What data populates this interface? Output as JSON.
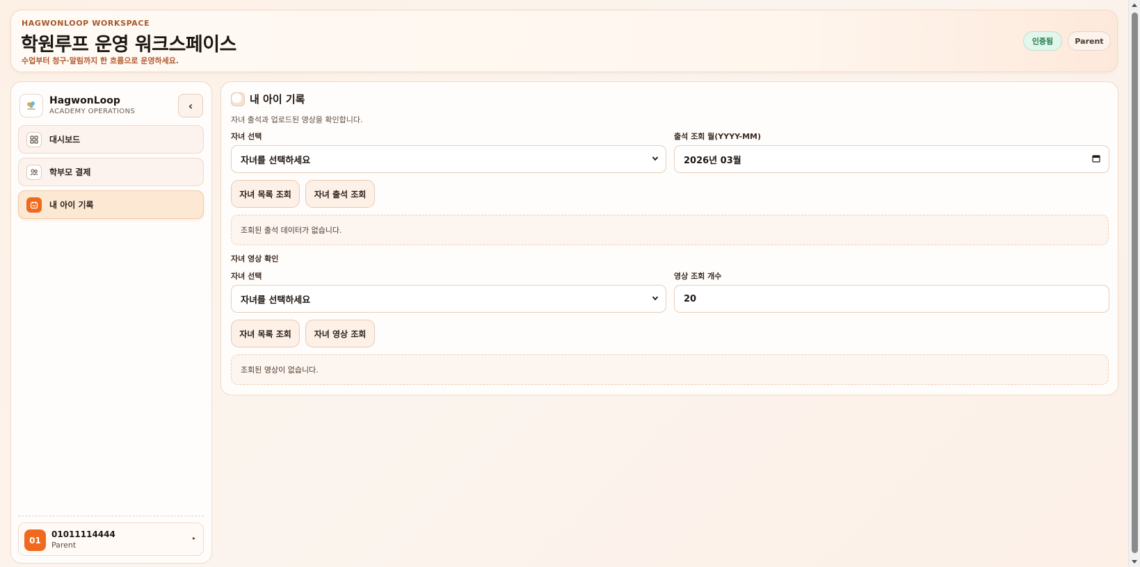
{
  "header": {
    "kicker": "HAGWONLOOP WORKSPACE",
    "title": "학원루프 운영 워크스페이스",
    "subtitle": "수업부터 청구·알림까지 한 흐름으로 운영하세요.",
    "badge_auth": "인증됨",
    "badge_role": "Parent"
  },
  "sidebar": {
    "brand_name": "HagwonLoop",
    "brand_sub": "ACADEMY OPERATIONS",
    "collapse_label": "‹",
    "items": [
      {
        "label": "대시보드",
        "icon": "dashboard-grid-icon",
        "active": false
      },
      {
        "label": "학부모 결제",
        "icon": "parents-users-icon",
        "active": false
      },
      {
        "label": "내 아이 기록",
        "icon": "calendar-record-icon",
        "active": true
      }
    ],
    "user": {
      "avatar": "01",
      "phone": "01011114444",
      "role": "Parent",
      "caret": "▸"
    }
  },
  "main": {
    "section_title": "내 아이 기록",
    "section_desc": "자녀 출석과 업로드된 영상을 확인합니다.",
    "attendance": {
      "child_label": "자녀 선택",
      "child_selected": "자녀를 선택하세요",
      "month_label": "출석 조회 월(YYYY-MM)",
      "month_value": "2026년 03월",
      "btn_list": "자녀 목록 조회",
      "btn_query": "자녀 출석 조회",
      "empty_text": "조회된 출석 데이터가 없습니다."
    },
    "video": {
      "section_title": "자녀 영상 확인",
      "child_label": "자녀 선택",
      "child_selected": "자녀를 선택하세요",
      "count_label": "영상 조회 개수",
      "count_value": "20",
      "btn_list": "자녀 목록 조회",
      "btn_query": "자녀 영상 조회",
      "empty_text": "조회된 영상이 없습니다."
    }
  },
  "colors": {
    "accent": "#ef6a1e",
    "badge_auth_bg": "#e3f6ec",
    "badge_auth_text": "#1d7a4a",
    "brand_kicker": "#a4582a"
  }
}
